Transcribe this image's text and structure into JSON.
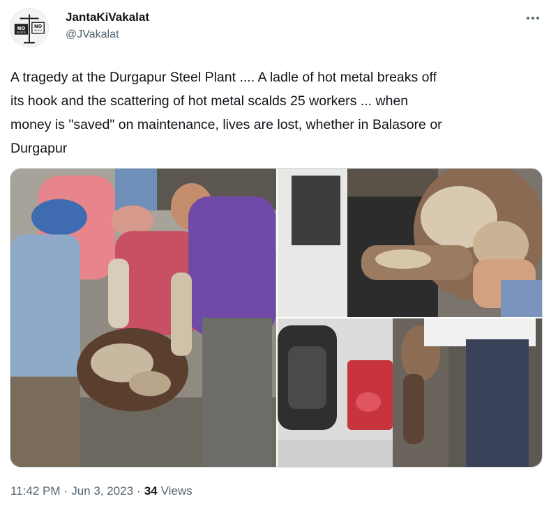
{
  "author": {
    "name": "JantaKiVakalat",
    "handle": "@JVakalat",
    "avatar_text_1": "NO",
    "avatar_text_2": "JUSTICE",
    "avatar_text_3": "NO",
    "avatar_text_4": "PEACE"
  },
  "tweet": {
    "text": "A tragedy at the Durgapur Steel Plant .... A ladle of hot metal breaks off\nits hook and the scattering of hot metal scalds 25 workers ... when\nmoney is \"saved\" on maintenance, lives are lost, whether in Balasore or\nDurgapur"
  },
  "media": {
    "count": 3,
    "icons": [
      "photo-left",
      "photo-top-right",
      "photo-bottom-right"
    ]
  },
  "footer": {
    "time": "11:42 PM",
    "separator": "·",
    "date": "Jun 3, 2023",
    "views_count": "34",
    "views_label": "Views"
  },
  "colors": {
    "text": "#0f1419",
    "secondary": "#536471",
    "border": "#cfd9de"
  }
}
